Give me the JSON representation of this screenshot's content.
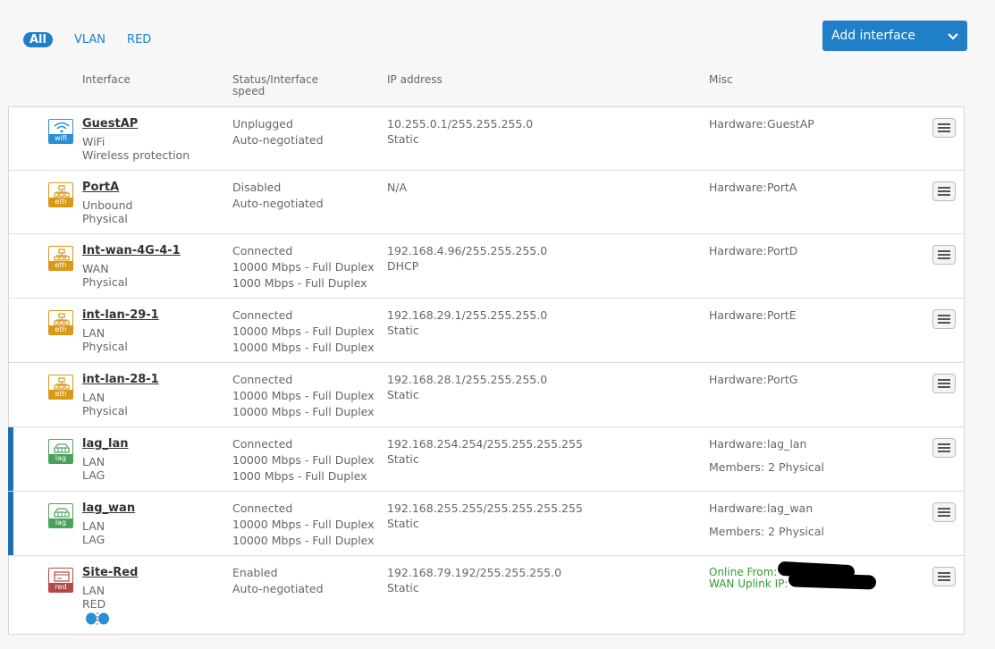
{
  "filters": {
    "all": "All",
    "vlan": "VLAN",
    "red": "RED"
  },
  "add_button": {
    "label": "Add interface"
  },
  "columns": {
    "interface": "Interface",
    "status_line1": "Status/Interface",
    "status_line2": "speed",
    "ip": "IP address",
    "misc": "Misc"
  },
  "rows": [
    {
      "name": "GuestAP",
      "icon_tag": "wifi",
      "zone": "WiFi",
      "type": "Wireless protection",
      "status": [
        "Unplugged",
        "Auto-negotiated"
      ],
      "ip": "10.255.0.1/255.255.255.0",
      "ip_mode": "Static",
      "hardware_label": "Hardware:",
      "hardware": "GuestAP"
    },
    {
      "name": "PortA",
      "icon_tag": "eth",
      "zone": "Unbound",
      "type": "Physical",
      "status": [
        "Disabled",
        "Auto-negotiated"
      ],
      "ip": "N/A",
      "ip_mode": "",
      "hardware_label": "Hardware:",
      "hardware": "PortA"
    },
    {
      "name": "Int-wan-4G-4-1",
      "icon_tag": "eth",
      "zone": "WAN",
      "type": "Physical",
      "status": [
        "Connected",
        "10000 Mbps - Full Duplex",
        "1000 Mbps - Full Duplex"
      ],
      "ip": "192.168.4.96/255.255.255.0",
      "ip_mode": "DHCP",
      "hardware_label": "Hardware:",
      "hardware": "PortD"
    },
    {
      "name": "int-lan-29-1",
      "icon_tag": "eth",
      "zone": "LAN",
      "type": "Physical",
      "status": [
        "Connected",
        "10000 Mbps - Full Duplex",
        "10000 Mbps - Full Duplex"
      ],
      "ip": "192.168.29.1/255.255.255.0",
      "ip_mode": "Static",
      "hardware_label": "Hardware:",
      "hardware": "PortE"
    },
    {
      "name": "int-lan-28-1",
      "icon_tag": "eth",
      "zone": "LAN",
      "type": "Physical",
      "status": [
        "Connected",
        "10000 Mbps - Full Duplex",
        "10000 Mbps - Full Duplex"
      ],
      "ip": "192.168.28.1/255.255.255.0",
      "ip_mode": "Static",
      "hardware_label": "Hardware:",
      "hardware": "PortG"
    },
    {
      "name": "lag_lan",
      "icon_tag": "lag",
      "zone": "LAN",
      "type": "LAG",
      "status": [
        "Connected",
        "10000 Mbps - Full Duplex",
        "1000 Mbps - Full Duplex"
      ],
      "ip": "192.168.254.254/255.255.255.255",
      "ip_mode": "Static",
      "hardware_label": "Hardware:",
      "hardware": "lag_lan",
      "members": "Members: 2 Physical"
    },
    {
      "name": "lag_wan",
      "icon_tag": "lag",
      "zone": "LAN",
      "type": "LAG",
      "status": [
        "Connected",
        "10000 Mbps - Full Duplex",
        "10000 Mbps - Full Duplex"
      ],
      "ip": "192.168.255.255/255.255.255.255",
      "ip_mode": "Static",
      "hardware_label": "Hardware:",
      "hardware": "lag_wan",
      "members": "Members: 2 Physical"
    },
    {
      "name": "Site-Red",
      "icon_tag": "red",
      "zone": "LAN",
      "type": "RED",
      "status": [
        "Enabled",
        "Auto-negotiated"
      ],
      "ip": "192.168.79.192/255.255.255.0",
      "ip_mode": "Static",
      "online_from": "Online From:",
      "wan_uplink": "WAN Uplink IP:"
    }
  ],
  "colors": {
    "accent": "#1f7fc9",
    "wifi": "#2a8fd6",
    "eth": "#d89a18",
    "lag": "#4aa15a",
    "red": "#b24a4a",
    "online": "#2f9a2f"
  }
}
